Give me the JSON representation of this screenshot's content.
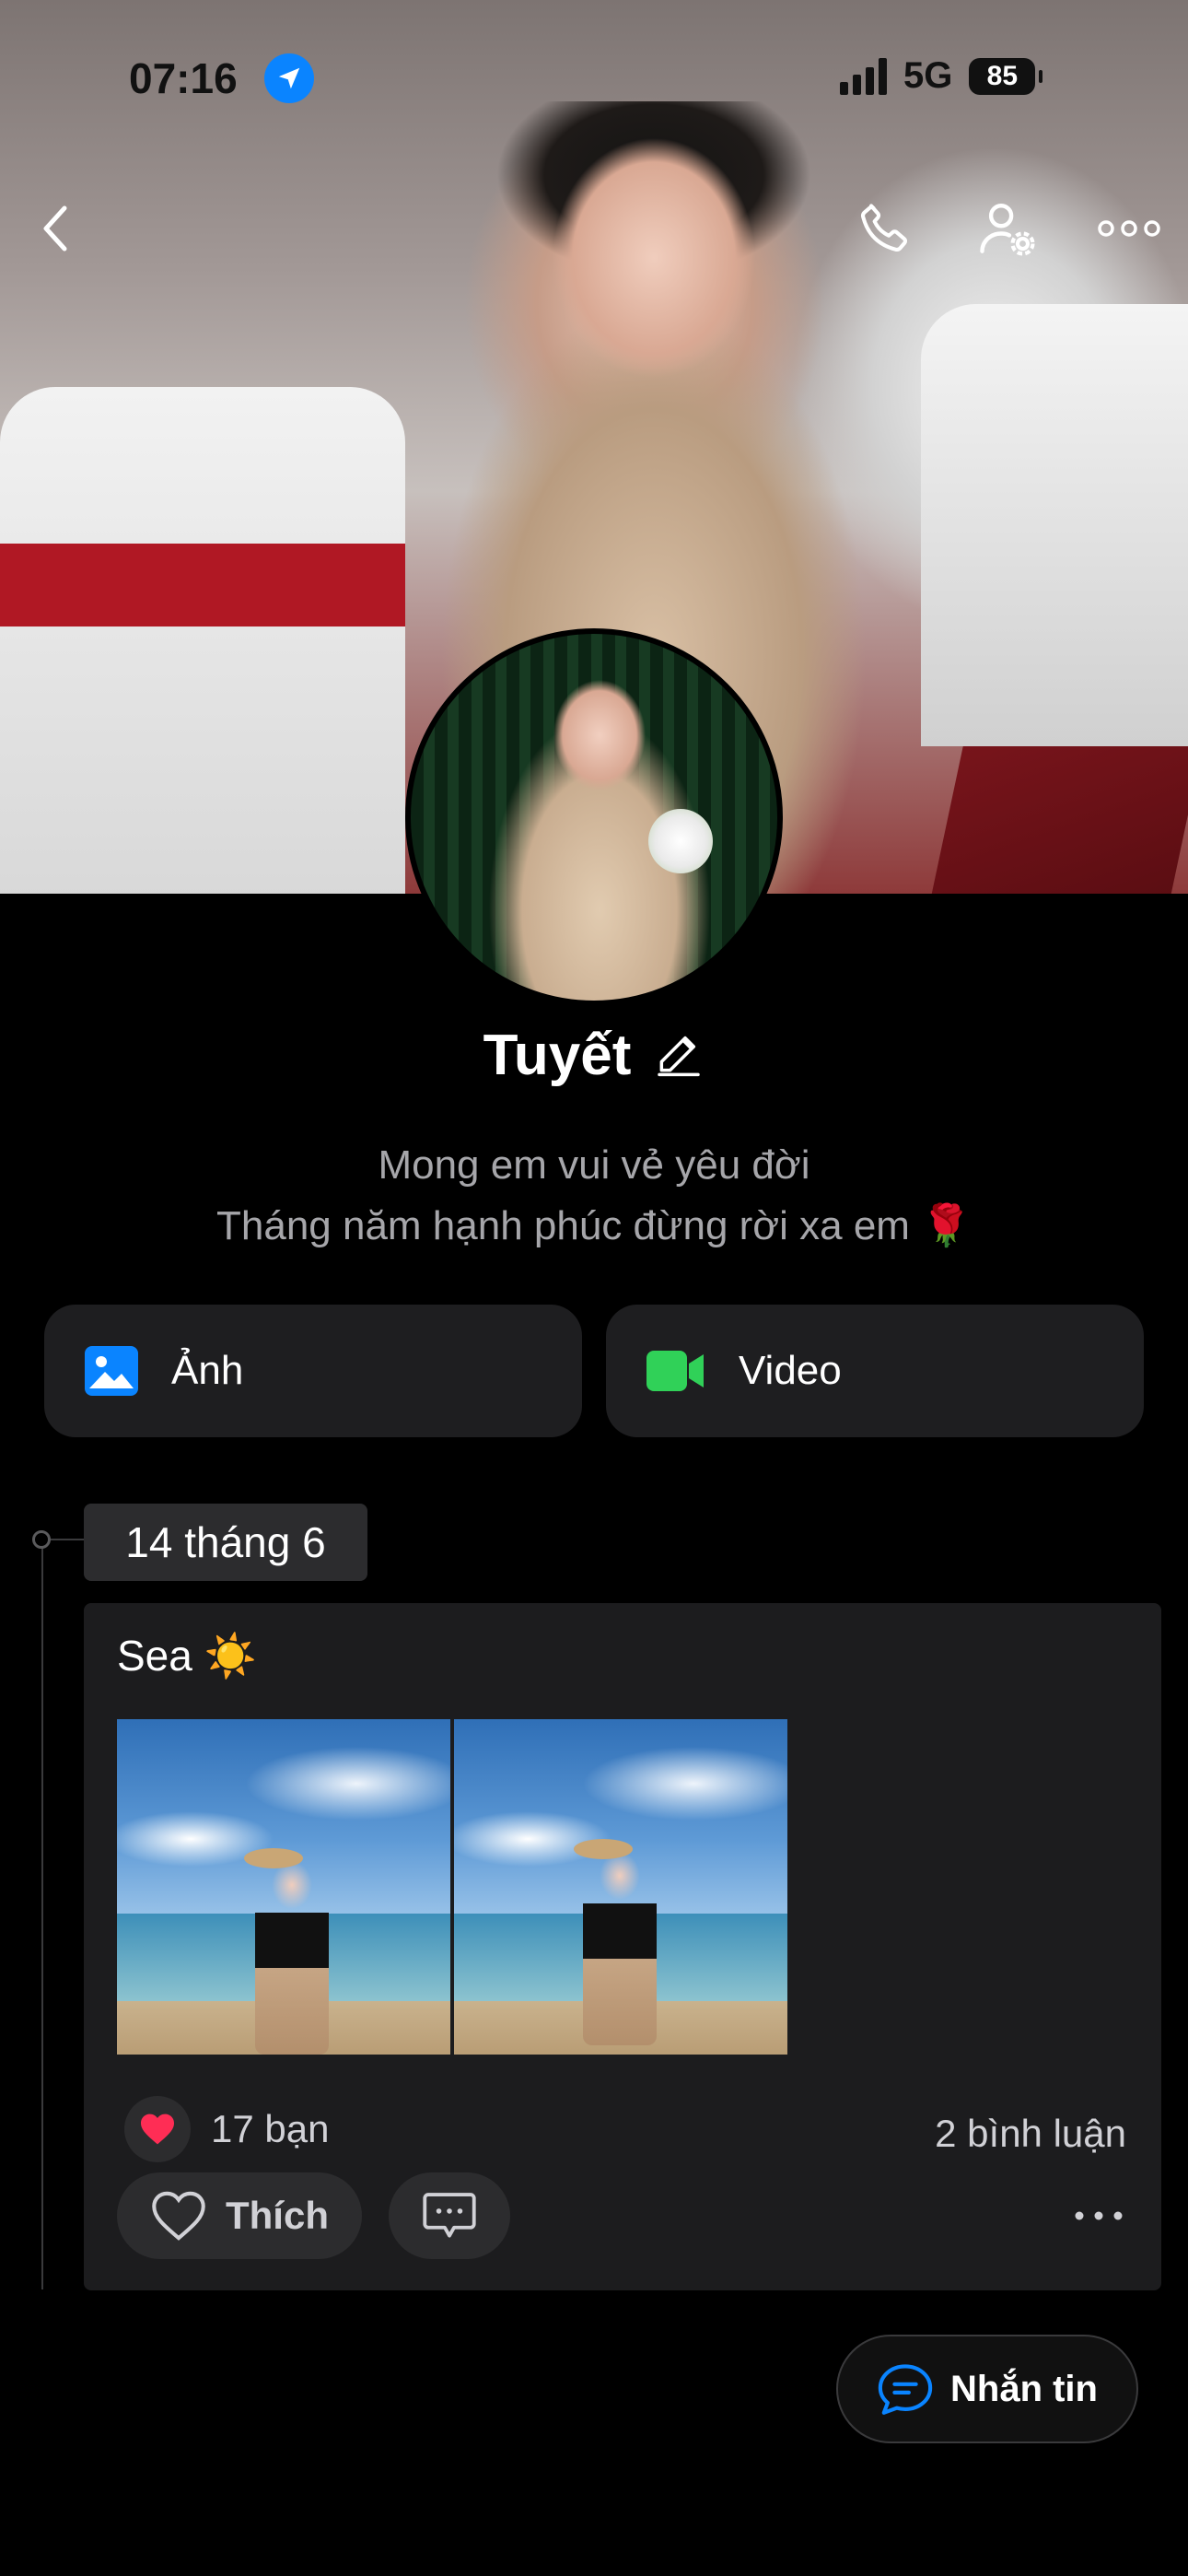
{
  "status_bar": {
    "time": "07:16",
    "network": "5G",
    "battery": "85"
  },
  "profile": {
    "name": "Tuyết",
    "bio_line1": "Mong em vui vẻ yêu đời",
    "bio_line2": "Tháng năm hạnh phúc đừng rời xa em 🌹"
  },
  "media": {
    "photos_label": "Ảnh",
    "videos_label": "Video"
  },
  "timeline": {
    "date": "14 tháng 6",
    "post": {
      "caption": "Sea ☀️",
      "likes": "17 bạn",
      "comments": "2 bình luận",
      "like_label": "Thích"
    }
  },
  "message_button": {
    "label": "Nhắn tin"
  },
  "colors": {
    "accent": "#0a84ff",
    "video_green": "#30d158",
    "background": "#000000",
    "card": "#1c1c1e"
  }
}
